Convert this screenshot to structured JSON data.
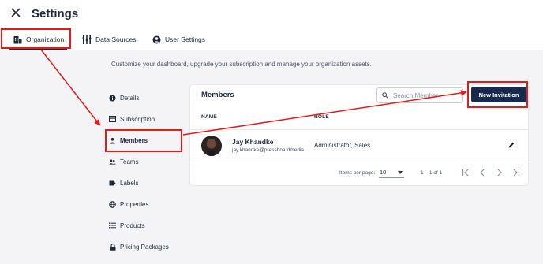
{
  "header": {
    "title": "Settings"
  },
  "tabs": [
    {
      "label": "Organization",
      "icon": "building-icon",
      "active": true
    },
    {
      "label": "Data Sources",
      "icon": "grid-dots-icon",
      "active": false
    },
    {
      "label": "User Settings",
      "icon": "user-circle-icon",
      "active": false
    }
  ],
  "subtitle": "Customize your dashboard, upgrade your subscription and manage your organization assets.",
  "sidenav": [
    {
      "label": "Details",
      "icon": "info-icon"
    },
    {
      "label": "Subscription",
      "icon": "card-icon"
    },
    {
      "label": "Members",
      "icon": "person-icon",
      "active": true
    },
    {
      "label": "Teams",
      "icon": "group-icon"
    },
    {
      "label": "Labels",
      "icon": "label-icon"
    },
    {
      "label": "Properties",
      "icon": "globe-icon"
    },
    {
      "label": "Products",
      "icon": "list-icon"
    },
    {
      "label": "Pricing Packages",
      "icon": "lock-icon"
    }
  ],
  "members": {
    "title": "Members",
    "search_placeholder": "Search Member",
    "new_button": "New Invitation",
    "columns": [
      "NAME",
      "ROLE"
    ],
    "rows": [
      {
        "name": "Jay Khandke",
        "email": "jay.khandke@pressboardmedia",
        "role": "Administrator, Sales"
      }
    ],
    "pagination": {
      "items_per_page_label": "Items per page:",
      "items_per_page": "10",
      "range": "1 – 1 of 1"
    }
  },
  "colors": {
    "accent": "#17294d",
    "annotation": "#e21b1b",
    "background": "#f4f4f6"
  }
}
